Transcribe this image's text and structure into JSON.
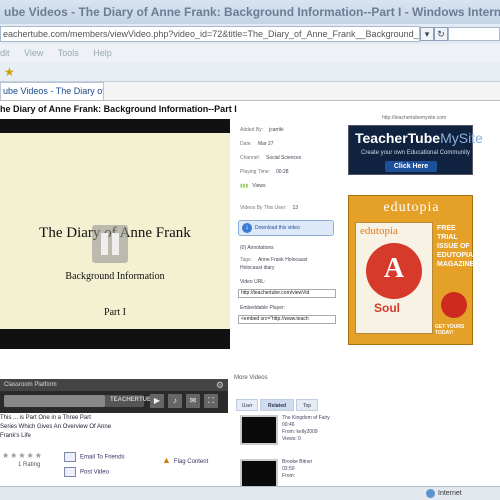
{
  "browser": {
    "title": "ube Videos - The Diary of Anne Frank: Background Information--Part I - Windows Internet E",
    "address": "eachertube.com/members/viewVideo.php?video_id=72&title=The_Diary_of_Anne_Frank__Background_Informa",
    "menu": [
      "dit",
      "View",
      "Tools",
      "Help"
    ],
    "tab_label": "ube Videos - The Diary of A..."
  },
  "page": {
    "title": "he Diary of Anne Frank: Background Information--Part I"
  },
  "video": {
    "title_line1": "The Diary of Anne Frank",
    "title_line2": "Background Information",
    "title_line3": "Part I",
    "controls_label": "Classroom Platform",
    "progress_fraction": 0.72,
    "brand_logo": "TEACHERTUBE",
    "description_line1": "This ... is Part One in a Three Part",
    "description_line2": "Series Which Gives An Overview Of Anne",
    "description_line3": "Frank's Life",
    "rating_stars": "★★★★★",
    "rating_count": "1 Rating",
    "action_email": "Email To Friends",
    "action_post": "Post Video",
    "action_flag": "Flag Content"
  },
  "info": {
    "added_by_key": "Added By:",
    "added_by_val": "jcarriki",
    "date_key": "Date:",
    "date_val": "Mar 27",
    "channel_key": "Channel:",
    "channel_val": "Social Sciences",
    "playing_key": "Playing Time:",
    "playing_val": "00:28",
    "views_label": "Views",
    "video_by_user_key": "Videos By This User:",
    "video_by_user_val": "13",
    "download_label": "Download this video",
    "comments": "(0) Annotations",
    "tags_key": "Tags:",
    "tags_val": "Anne Frank Holocaust",
    "tags_val2": "Holocaust diary",
    "video_url_label": "Video URL:",
    "video_url_val": "http://teachertube.com/viewVid",
    "embed_label": "Embeddable Player:",
    "embed_val": "<embed src=\"http://www.teach",
    "more_videos": "More Videos",
    "tab_user": "User",
    "tab_related": "Related",
    "tab_top": "Top",
    "rel1_title": "The Kingdom of Fairy",
    "rel1_len": "00:46",
    "rel1_from": "From: kelly2009",
    "rel1_views": "Views: 0",
    "rel2_title": "Brooke Bitner",
    "rel2_len": "03:50",
    "rel2_from": "From:"
  },
  "ads": {
    "url": "http://teachertubemysite.com",
    "ad1_brand": "TeacherTube",
    "ad1_brand2": "MySite",
    "ad1_sub": "Create your own Educational Community",
    "ad1_click": "Click Here",
    "ad2_logo": "edutopia",
    "ad2_mag": "edutopia",
    "ad2_art": "A",
    "ad2_soul": "Soul",
    "ad2_promo": "FREE TRIAL ISSUE OF EDUTOPIA MAGAZINE",
    "ad2_cta": "GET YOURS TODAY!"
  },
  "status": {
    "zone": "Internet"
  },
  "colors": {
    "chrome": "#c4d3e6",
    "video_bg": "#f3f1d2",
    "ad_orange": "#e5a028",
    "ad_navy": "#0f2240"
  }
}
